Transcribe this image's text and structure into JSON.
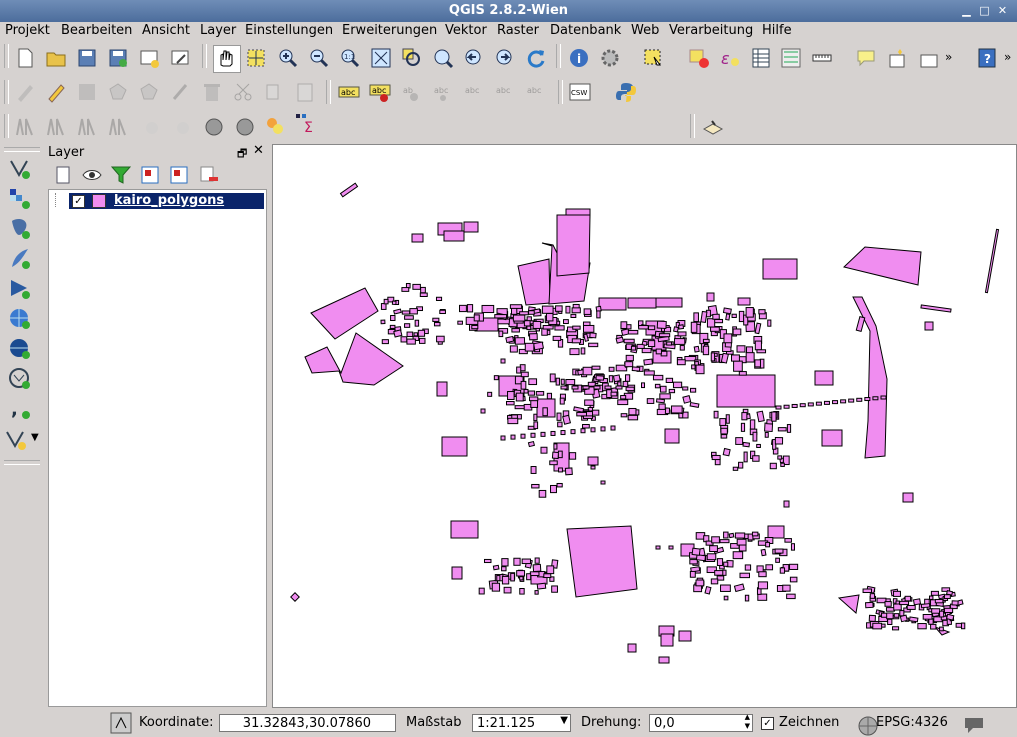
{
  "window": {
    "title": "QGIS 2.8.2-Wien"
  },
  "menu": [
    "Projekt",
    "Bearbeiten",
    "Ansicht",
    "Layer",
    "Einstellungen",
    "Erweiterungen",
    "Vektor",
    "Raster",
    "Datenbank",
    "Web",
    "Verarbeitung",
    "Hilfe"
  ],
  "toolbars": {
    "file": [
      "new-project-icon",
      "open-project-icon",
      "save-project-icon",
      "save-as-icon",
      "new-print-composer-icon",
      "composer-manager-icon"
    ],
    "nav": [
      "pan-icon",
      "pan-to-selection-icon",
      "zoom-in-icon",
      "zoom-out-icon",
      "zoom-actual-icon",
      "zoom-full-icon",
      "zoom-to-selection-icon",
      "zoom-to-layer-icon",
      "zoom-last-icon",
      "zoom-next-icon",
      "refresh-icon"
    ],
    "attr": [
      "identify-icon",
      "action-icon",
      "select-icon",
      "deselect-icon",
      "expression-select-icon",
      "attribute-table-icon",
      "statistics-icon",
      "measure-icon",
      "map-tips-icon",
      "text-annotation-icon",
      "more-icon",
      "help-icon"
    ],
    "digitize": [
      "current-edits-icon",
      "toggle-edit-icon",
      "save-edits-icon",
      "add-feature-icon",
      "move-feature-icon",
      "node-tool-icon",
      "delete-selected-icon",
      "cut-features-icon",
      "copy-features-icon",
      "paste-features-icon"
    ],
    "label": [
      "label-toolbar-icon",
      "pin-labels-icon",
      "show-hide-labels-icon",
      "move-label-icon",
      "rotate-label-icon",
      "change-label-icon",
      "label-edit-icon"
    ],
    "web": [
      "csw-icon",
      "python-icon"
    ],
    "advanced": [
      "simplify-icon",
      "add-ring-icon",
      "add-part-icon",
      "fill-ring-icon",
      "delete-ring-icon",
      "delete-part-icon",
      "reshape-icon",
      "offset-curve-icon",
      "split-icon",
      "heatmap-icon",
      "field-calculator-icon"
    ],
    "extra": [
      "georeferencer-icon"
    ],
    "left_layers": [
      "add-vector-layer-icon",
      "add-raster-layer-icon",
      "add-postgis-layer-icon",
      "add-spatialite-layer-icon",
      "add-mssql-layer-icon",
      "add-wms-layer-icon",
      "add-wcs-layer-icon",
      "add-wfs-layer-icon",
      "add-delimited-text-icon",
      "new-shapefile-icon"
    ]
  },
  "layer_panel": {
    "title": "Layer",
    "layers": [
      {
        "name": "kairo_polygons",
        "checked": true,
        "color": "#f08df0"
      }
    ]
  },
  "map": {
    "fill_color": "#f08df0",
    "stroke_color": "#000000"
  },
  "statusbar": {
    "coord_label": "Koordinate:",
    "coord_value": "31.32843,30.07860",
    "scale_label": "Maßstab",
    "scale_value": "1:21.125",
    "rotation_label": "Drehung:",
    "rotation_value": "0,0",
    "render_label": "Zeichnen",
    "crs": "EPSG:4326"
  }
}
